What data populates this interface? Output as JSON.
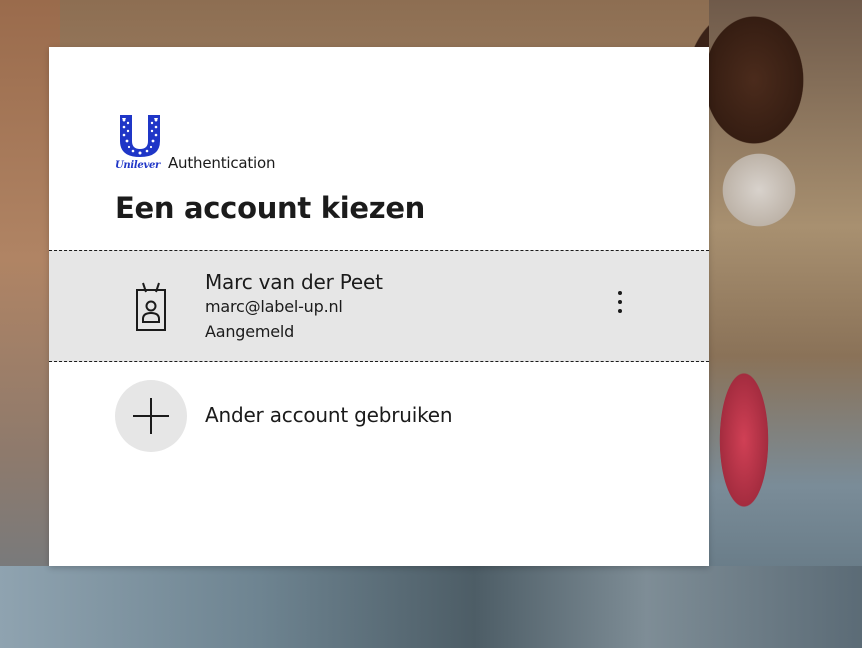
{
  "brand": {
    "logo_text": "Unilever",
    "logo_color": "#1f36c7",
    "suffix": "Authentication"
  },
  "title": "Een account kiezen",
  "accounts": [
    {
      "name": "Marc van der Peet",
      "email": "marc@label-up.nl",
      "status": "Aangemeld",
      "avatar_icon": "badge-person-icon",
      "menu_icon": "more-vertical-icon"
    }
  ],
  "other_account": {
    "label": "Ander account gebruiken",
    "icon": "plus-icon"
  },
  "colors": {
    "selected_row_bg": "#e6e6e6",
    "text": "#1b1b1b",
    "card_bg": "#ffffff"
  }
}
